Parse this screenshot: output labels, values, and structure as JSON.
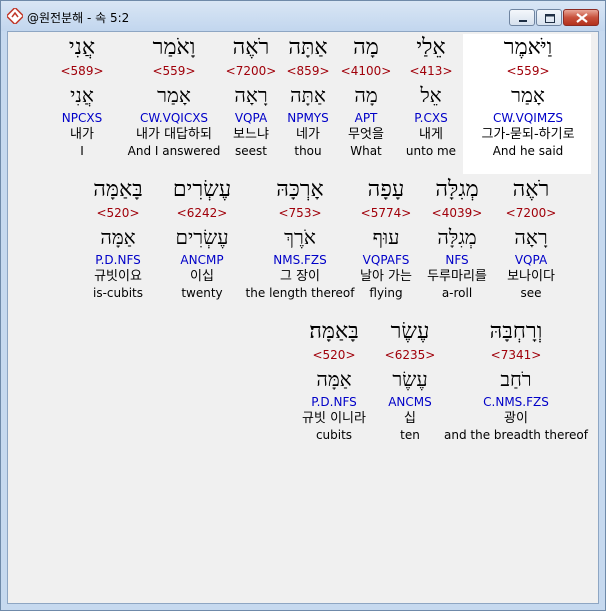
{
  "window": {
    "title": "@원전분해 - 속 5:2"
  },
  "verse_lines": [
    [
      {
        "heb": "וַיֹּאמֶר",
        "num": "<559>",
        "lex": "אָמַר",
        "parse": "CW.VQIMZS",
        "kor": "그가-묻되-하기로",
        "eng": "And he said",
        "highlight": true
      },
      {
        "heb": "אֵלַי",
        "num": "<413>",
        "lex": "אֵל",
        "parse": "P.CXS",
        "kor": "내게",
        "eng": "unto me"
      },
      {
        "heb": "מָה",
        "num": "<4100>",
        "lex": "מָה",
        "parse": "APT",
        "kor": "무엇을",
        "eng": "What"
      },
      {
        "heb": "אַתָּה",
        "num": "<859>",
        "lex": "אַתָּה",
        "parse": "NPMYS",
        "kor": "네가",
        "eng": "thou"
      },
      {
        "heb": "רֹאֶה",
        "num": "<7200>",
        "lex": "רָאָה",
        "parse": "VQPA",
        "kor": "보느냐",
        "eng": "seest"
      },
      {
        "heb": "וָאֹמַר",
        "num": "<559>",
        "lex": "אָמַר",
        "parse": "CW.VQICXS",
        "kor": "내가 대답하되",
        "eng": "And I answered"
      },
      {
        "heb": "אֲנִי",
        "num": "<589>",
        "lex": "אֲנִי",
        "parse": "NPCXS",
        "kor": "내가",
        "eng": "I"
      }
    ],
    [
      {
        "heb": "רֹאֶה",
        "num": "<7200>",
        "lex": "רָאָה",
        "parse": "VQPA",
        "kor": "보나이다",
        "eng": "see"
      },
      {
        "heb": "מְגִלָּה",
        "num": "<4039>",
        "lex": "מְגִלָּה",
        "parse": "NFS",
        "kor": "두루마리를",
        "eng": "a-roll"
      },
      {
        "heb": "עָפָה",
        "num": "<5774>",
        "lex": "עוּף",
        "parse": "VQPAFS",
        "kor": "날아 가는",
        "eng": "flying"
      },
      {
        "heb": "אָרְכָּהּ",
        "num": "<753>",
        "lex": "אֹרֶךְ",
        "parse": "NMS.FZS",
        "kor": "그 장이",
        "eng": "the length thereof"
      },
      {
        "heb": "עֶשְׂרִים",
        "num": "<6242>",
        "lex": "עֶשְׂרִים",
        "parse": "ANCMP",
        "kor": "이십",
        "eng": "twenty"
      },
      {
        "heb": "בָּאַמָּה",
        "num": "<520>",
        "lex": "אַמָּה",
        "parse": "P.D.NFS",
        "kor": "규빗이요",
        "eng": "is-cubits"
      }
    ],
    [
      {
        "heb": "וְרָחְבָּהּ",
        "num": "<7341>",
        "lex": "רֹחַב",
        "parse": "C.NMS.FZS",
        "kor": "광이",
        "eng": "and the breadth thereof"
      },
      {
        "heb": "עֶשֶׂר",
        "num": "<6235>",
        "lex": "עֶשֶׂר",
        "parse": "ANCMS",
        "kor": "십",
        "eng": "ten"
      },
      {
        "heb": "בָּאַמָּה׃",
        "num": "<520>",
        "lex": "אַמָּה",
        "parse": "P.D.NFS",
        "kor": "규빗 이니라",
        "eng": "cubits"
      }
    ]
  ]
}
